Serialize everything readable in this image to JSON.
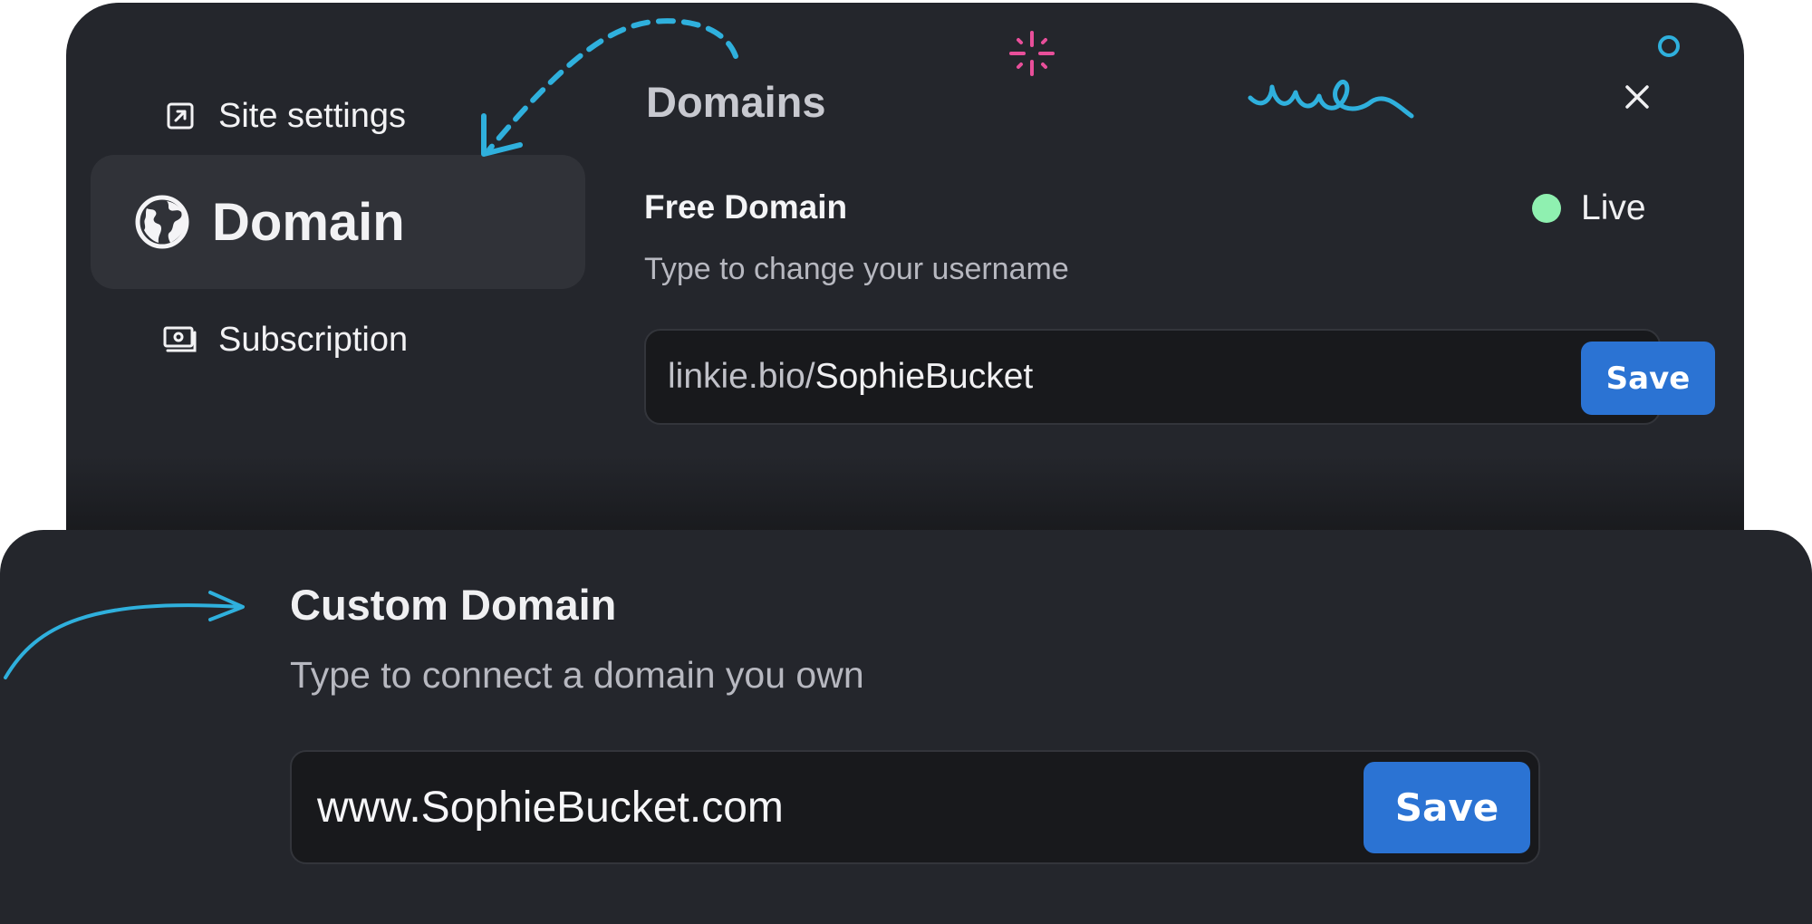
{
  "sidebar": {
    "items": [
      {
        "label": "Site settings",
        "icon": "external-link-square-icon"
      },
      {
        "label": "Domain",
        "icon": "globe-icon",
        "active": true
      },
      {
        "label": "Subscription",
        "icon": "money-icon"
      }
    ]
  },
  "header": {
    "title": "Domains"
  },
  "free_domain": {
    "title": "Free Domain",
    "subtitle": "Type to change your username",
    "status": "Live",
    "status_color": "#8ff0b0",
    "input_prefix": "linkie.bio/",
    "input_value": "SophieBucket",
    "save_label": "Save"
  },
  "custom_domain": {
    "title": "Custom Domain",
    "subtitle": "Type to connect a domain you own",
    "input_value": "www.SophieBucket.com",
    "save_label": "Save"
  },
  "colors": {
    "accent": "#2b73d3",
    "panel": "#24262c",
    "decoration": "#2fb0dd",
    "sparkle": "#e84f9a"
  }
}
